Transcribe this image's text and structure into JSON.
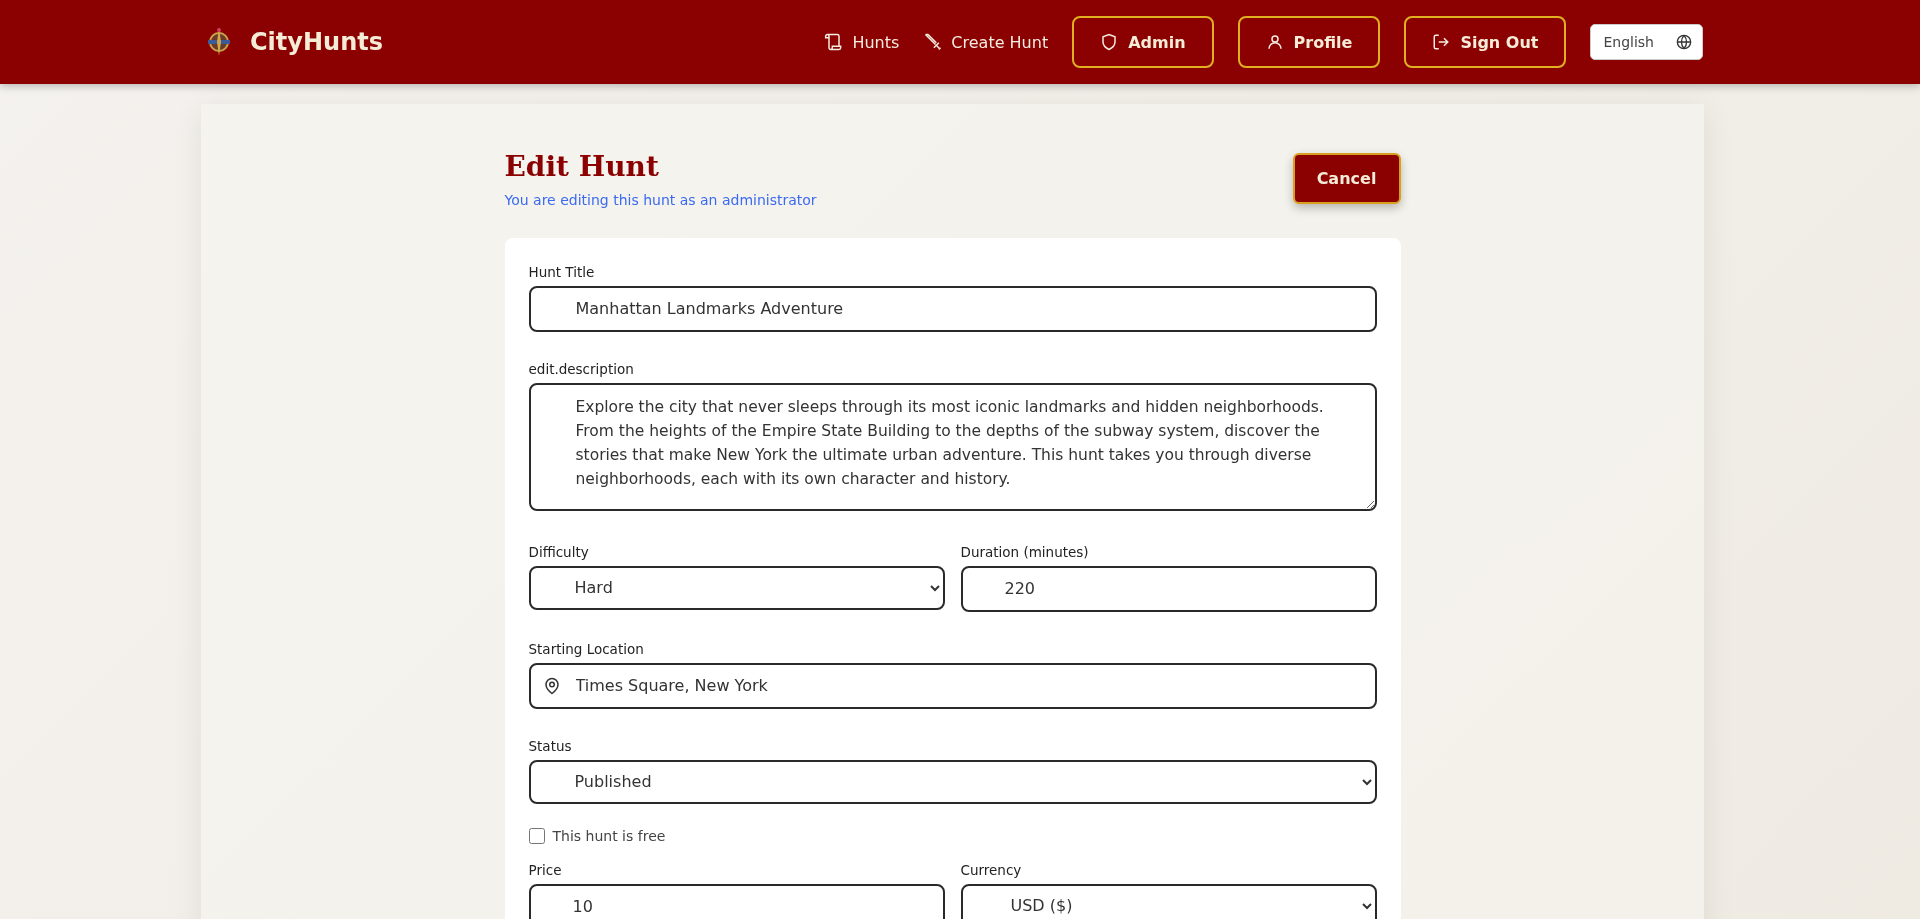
{
  "header": {
    "brand": "CityHunts",
    "nav": [
      {
        "label": "Hunts",
        "kind": "link"
      },
      {
        "label": "Create Hunt",
        "kind": "link"
      },
      {
        "label": "Admin",
        "kind": "button"
      },
      {
        "label": "Profile",
        "kind": "button"
      },
      {
        "label": "Sign Out",
        "kind": "button"
      }
    ],
    "language": "English"
  },
  "page": {
    "title": "Edit Hunt",
    "subtitle": "You are editing this hunt as an administrator",
    "cancel": "Cancel"
  },
  "form": {
    "title_label": "Hunt Title",
    "title_value": "Manhattan Landmarks Adventure",
    "description_label": "edit.description",
    "description_value": "Explore the city that never sleeps through its most iconic landmarks and hidden neighborhoods. From the heights of the Empire State Building to the depths of the subway system, discover the stories that make New York the ultimate urban adventure. This hunt takes you through diverse neighborhoods, each with its own character and history.",
    "difficulty_label": "Difficulty",
    "difficulty_value": "Hard",
    "duration_label": "Duration (minutes)",
    "duration_value": "220",
    "location_label": "Starting Location",
    "location_value": "Times Square, New York",
    "status_label": "Status",
    "status_value": "Published",
    "free_label": "This hunt is free",
    "free_checked": false,
    "price_label": "Price",
    "price_value": "10",
    "currency_label": "Currency",
    "currency_value": "USD ($)"
  }
}
